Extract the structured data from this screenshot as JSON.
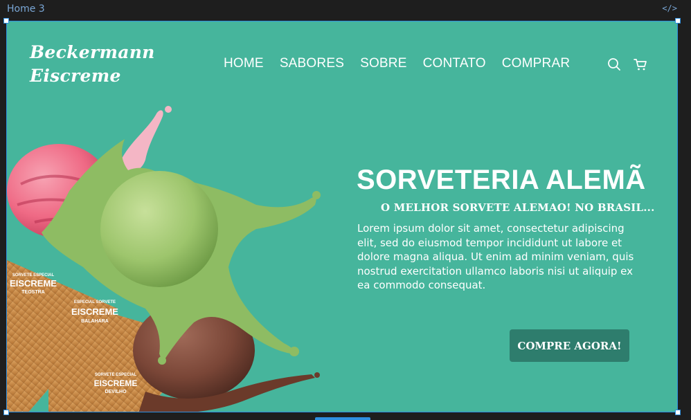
{
  "editor": {
    "frame_label": "Home 3",
    "code_icon": "</>"
  },
  "brand": {
    "line1": "Beckermann",
    "line2": "Eiscreme"
  },
  "nav": {
    "items": [
      "HOME",
      "SABORES",
      "SOBRE",
      "CONTATO",
      "COMPRAR"
    ]
  },
  "icons": {
    "search": "search-icon",
    "cart": "cart-icon"
  },
  "hero": {
    "title": "SORVETERIA ALEMÃ",
    "subtitle": "O MELHOR SORVETE ALEMAO! NO BRASIL...",
    "body": "Lorem ipsum dolor sit amet, consectetur adipiscing elit, sed do eiusmod tempor incididunt ut labore et dolore magna aliqua. Ut enim ad minim veniam, quis nostrud exercitation ullamco laboris nisi ut aliquip ex ea commodo consequat.",
    "cta": "COMPRE AGORA!"
  },
  "cones": [
    {
      "small": "SORVETE ESPECIAL",
      "brand": "EISCREME",
      "flavor": "TEOSTRA"
    },
    {
      "small": "ESPECIAL SORVETE",
      "brand": "EISCREME",
      "flavor": "BALAHARA"
    },
    {
      "small": "SORVETE ESPECIAL",
      "brand": "EISCREME",
      "flavor": "DEVILHO"
    }
  ],
  "colors": {
    "background": "#46b59c",
    "button": "#2e7d6d",
    "selection": "#2e8fe0"
  }
}
